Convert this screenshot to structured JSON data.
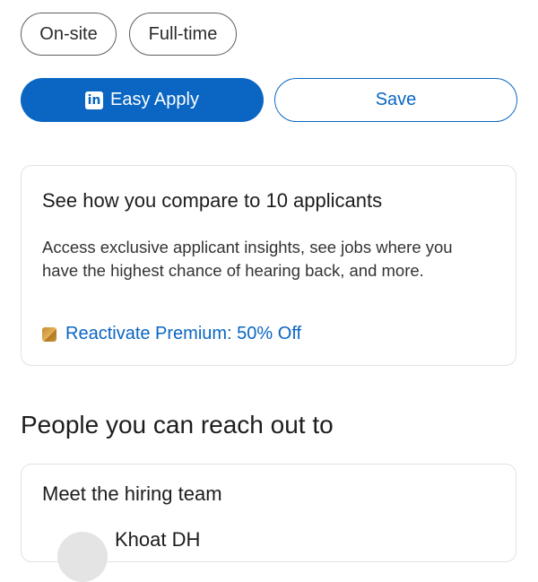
{
  "chips": {
    "onsite": "On-site",
    "fulltime": "Full-time"
  },
  "actions": {
    "apply_label": "Easy Apply",
    "save_label": "Save",
    "apply_icon": "linkedin-icon"
  },
  "premium_card": {
    "title": "See how you compare to 10 applicants",
    "body": "Access exclusive applicant insights, see jobs where you have the highest chance of hearing back, and more.",
    "link": "Reactivate Premium: 50% Off",
    "icon": "premium-icon"
  },
  "section": {
    "title": "People you can reach out to"
  },
  "team_card": {
    "title": "Meet the hiring team",
    "person_name": "Khoat DH"
  },
  "colors": {
    "accent": "#0a66c2",
    "premium_gold": "#c38a2e"
  }
}
